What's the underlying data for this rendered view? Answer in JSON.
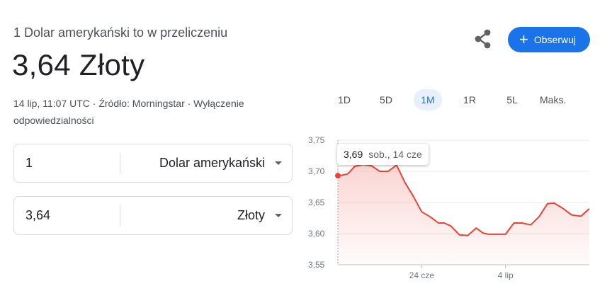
{
  "header": {
    "subtitle": "1 Dolar amerykański to w przeliczeniu",
    "value": "3,64 Złoty",
    "meta": "14 lip, 11:07 UTC · Źródło: Morningstar · Wyłączenie odpowiedzialności"
  },
  "actions": {
    "share_icon": "share-icon",
    "follow_label": "Obserwuj",
    "follow_color": "#1a73e8"
  },
  "converter": {
    "from": {
      "amount": "1",
      "unit": "Dolar amerykański"
    },
    "to": {
      "amount": "3,64",
      "unit": "Złoty"
    }
  },
  "ranges": {
    "items": [
      "1D",
      "5D",
      "1M",
      "1R",
      "5L",
      "Maks."
    ],
    "active": "1M"
  },
  "tooltip": {
    "value": "3,69",
    "date": "sob., 14 cze"
  },
  "chart_data": {
    "type": "area",
    "line_color": "#ea4335",
    "y_ticks": [
      "3,75",
      "3,70",
      "3,65",
      "3,60",
      "3,55"
    ],
    "ylim": [
      3.55,
      3.75
    ],
    "x_ticks": [
      {
        "label": "24 cze",
        "x": 10
      },
      {
        "label": "4 lip",
        "x": 20
      }
    ],
    "xlim": [
      0,
      30
    ],
    "grid": true,
    "x": [
      0,
      0.6,
      1.2,
      2,
      3,
      4,
      5,
      5.5,
      6,
      7,
      8,
      9,
      10,
      11,
      12,
      12.7,
      13.5,
      14.5,
      15.5,
      16.5,
      17.3,
      18,
      19,
      20,
      21,
      22,
      23,
      24,
      25,
      25.8,
      26.8,
      27.9,
      29,
      30
    ],
    "values": [
      3.693,
      3.694,
      3.696,
      3.708,
      3.711,
      3.709,
      3.7,
      3.7,
      3.7,
      3.71,
      3.682,
      3.66,
      3.635,
      3.627,
      3.617,
      3.617,
      3.612,
      3.598,
      3.597,
      3.609,
      3.601,
      3.599,
      3.599,
      3.599,
      3.617,
      3.617,
      3.614,
      3.627,
      3.648,
      3.649,
      3.641,
      3.63,
      3.628,
      3.64
    ]
  }
}
